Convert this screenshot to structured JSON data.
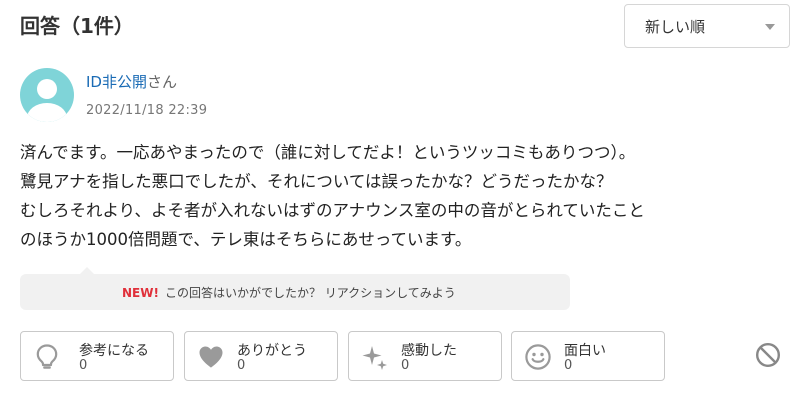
{
  "header": {
    "title": "回答（1件）"
  },
  "sort": {
    "selected": "新しい順"
  },
  "answer": {
    "user_id": "ID非公開",
    "user_suffix": "さん",
    "date": "2022/11/18 22:39",
    "lines": [
      "済んでます。一応あやまったので（誰に対してだよ！というツッコミもありつつ）。",
      "鷺見アナを指した悪口でしたが、それについては誤ったかな？どうだったかな？",
      "むしろそれより、よそ者が入れないはずのアナウンス室の中の音がとられていたこと",
      "のほうか1000倍問題で、テレ東はそちらにあせっています。"
    ]
  },
  "reaction_prompt": {
    "badge": "NEW!",
    "text": "この回答はいかがでしたか？ リアクションしてみよう"
  },
  "reactions": [
    {
      "label": "参考になる",
      "count": "0",
      "icon": "lightbulb-icon"
    },
    {
      "label": "ありがとう",
      "count": "0",
      "icon": "heart-icon"
    },
    {
      "label": "感動した",
      "count": "0",
      "icon": "sparkle-icon"
    },
    {
      "label": "面白い",
      "count": "0",
      "icon": "smile-icon"
    }
  ],
  "colors": {
    "link": "#1a6bb5",
    "new_badge": "#e0303a",
    "avatar": "#7fd4d8"
  }
}
